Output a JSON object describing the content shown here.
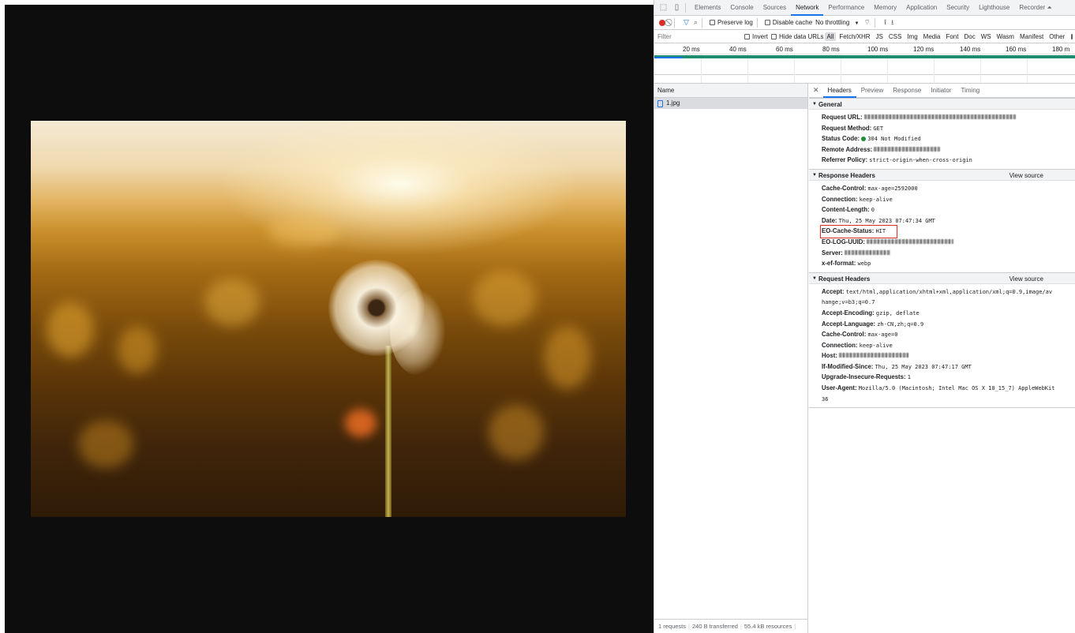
{
  "devtools": {
    "main_tabs": [
      "Elements",
      "Console",
      "Sources",
      "Network",
      "Performance",
      "Memory",
      "Application",
      "Security",
      "Lighthouse",
      "Recorder ⏶"
    ],
    "active_tab": "Network",
    "toolbar": {
      "preserve_log": "Preserve log",
      "disable_cache": "Disable cache",
      "throttling": "No throttling"
    },
    "filter": {
      "placeholder": "Filter",
      "invert": "Invert",
      "hide_data_urls": "Hide data URLs",
      "types": [
        "All",
        "Fetch/XHR",
        "JS",
        "CSS",
        "Img",
        "Media",
        "Font",
        "Doc",
        "WS",
        "Wasm",
        "Manifest",
        "Other"
      ]
    },
    "timeline": {
      "labels": [
        "20 ms",
        "40 ms",
        "60 ms",
        "80 ms",
        "100 ms",
        "120 ms",
        "140 ms",
        "160 ms",
        "180 m"
      ]
    },
    "requests": {
      "name_header": "Name",
      "file": "1.jpg"
    },
    "status_bar": {
      "requests": "1 requests",
      "transferred": "240 B transferred",
      "resources": "55.4 kB resources"
    },
    "detail_tabs": [
      "Headers",
      "Preview",
      "Response",
      "Initiator",
      "Timing"
    ],
    "general": {
      "title": "General",
      "request_url_label": "Request URL:",
      "request_method_label": "Request Method:",
      "request_method": "GET",
      "status_code_label": "Status Code:",
      "status_code": "304 Not Modified",
      "remote_address_label": "Remote Address:",
      "referrer_policy_label": "Referrer Policy:",
      "referrer_policy": "strict-origin-when-cross-origin"
    },
    "response_headers": {
      "title": "Response Headers",
      "view_source": "View source",
      "cache_control_label": "Cache-Control:",
      "cache_control": "max-age=2592000",
      "connection_label": "Connection:",
      "connection": "keep-alive",
      "content_length_label": "Content-Length:",
      "content_length": "0",
      "date_label": "Date:",
      "date": "Thu, 25 May 2023 07:47:34 GMT",
      "eo_cache_status_label": "EO-Cache-Status:",
      "eo_cache_status": "HIT",
      "eo_log_uuid_label": "EO-LOG-UUID:",
      "server_label": "Server:",
      "x_ef_format_label": "x-ef-format:",
      "x_ef_format": "webp"
    },
    "request_headers": {
      "title": "Request Headers",
      "view_source": "View source",
      "accept_label": "Accept:",
      "accept": "text/html,application/xhtml+xml,application/xml;q=0.9,image/av",
      "accept_cont": "hange;v=b3;q=0.7",
      "accept_encoding_label": "Accept-Encoding:",
      "accept_encoding": "gzip, deflate",
      "accept_language_label": "Accept-Language:",
      "accept_language": "zh-CN,zh;q=0.9",
      "cache_control_label": "Cache-Control:",
      "cache_control": "max-age=0",
      "connection_label": "Connection:",
      "connection": "keep-alive",
      "host_label": "Host:",
      "if_modified_since_label": "If-Modified-Since:",
      "if_modified_since": "Thu, 25 May 2023 07:47:17 GMT",
      "upgrade_label": "Upgrade-Insecure-Requests:",
      "upgrade": "1",
      "user_agent_label": "User-Agent:",
      "user_agent": "Mozilla/5.0 (Macintosh; Intel Mac OS X 10_15_7) AppleWebKit",
      "user_agent_cont": "36"
    },
    "colors": {
      "accent": "#1a73e8",
      "record": "#d93025",
      "status_ok": "#1e8e3e",
      "highlight_box": "#d93025"
    }
  }
}
